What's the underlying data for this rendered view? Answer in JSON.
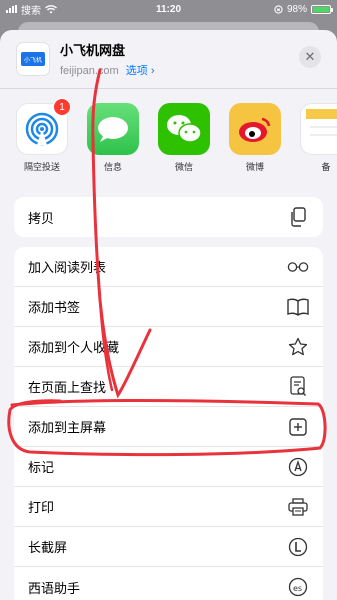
{
  "status": {
    "left_label": "搜索",
    "time": "11:20",
    "battery_text": "98%",
    "battery_level": 0.98
  },
  "header": {
    "title": "小飞机网盘",
    "subtitle": "feijipan.com",
    "options_label": "选项 ›",
    "app_icon_text": "小飞机",
    "close_glyph": "✕"
  },
  "apps": [
    {
      "label": "隔空投送",
      "icon": "airdrop-icon",
      "badge": "1"
    },
    {
      "label": "信息",
      "icon": "messages-icon"
    },
    {
      "label": "微信",
      "icon": "wechat-icon"
    },
    {
      "label": "微博",
      "icon": "weibo-icon"
    },
    {
      "label": "备",
      "icon": "notes-icon"
    }
  ],
  "actions": {
    "copy": {
      "label": "拷贝",
      "icon": "copy-icon"
    },
    "reading_list": {
      "label": "加入阅读列表",
      "icon": "glasses-icon"
    },
    "bookmark": {
      "label": "添加书签",
      "icon": "book-icon"
    },
    "favorites": {
      "label": "添加到个人收藏",
      "icon": "star-icon"
    },
    "find": {
      "label": "在页面上查找",
      "icon": "find-doc-icon"
    },
    "home_screen": {
      "label": "添加到主屏幕",
      "icon": "add-square-icon"
    },
    "markup": {
      "label": "标记",
      "icon": "pen-icon"
    },
    "print": {
      "label": "打印",
      "icon": "printer-icon"
    },
    "long_screenshot": {
      "label": "长截屏",
      "icon": "l-circle-icon"
    },
    "translate": {
      "label": "西语助手",
      "icon": "translate-icon"
    }
  },
  "colors": {
    "annotation": "#e8323c",
    "accent": "#007aff"
  }
}
